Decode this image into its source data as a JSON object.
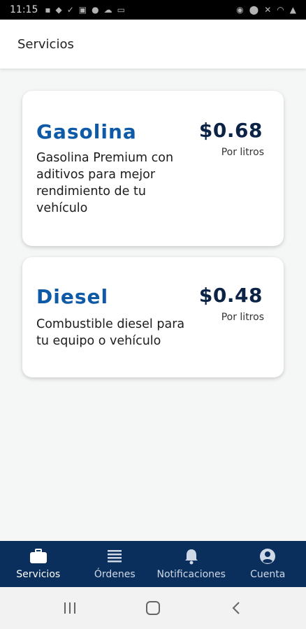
{
  "status_bar": {
    "time": "11:15"
  },
  "app_bar": {
    "title": "Servicios"
  },
  "services": [
    {
      "name": "Gasolina",
      "price": "$0.68",
      "unit": "Por litros",
      "description": "Gasolina Premium con aditivos para mejor rendimiento de tu vehículo"
    },
    {
      "name": "Diesel",
      "price": "$0.48",
      "unit": "Por litros",
      "description": "Combustible diesel para tu equipo o vehículo"
    }
  ],
  "bottom_nav": {
    "items": [
      {
        "label": "Servicios",
        "icon": "briefcase-icon",
        "active": true
      },
      {
        "label": "Órdenes",
        "icon": "list-icon",
        "active": false
      },
      {
        "label": "Notificaciones",
        "icon": "bell-icon",
        "active": false
      },
      {
        "label": "Cuenta",
        "icon": "account-circle-icon",
        "active": false
      }
    ]
  },
  "colors": {
    "brand_blue": "#0e5aa7",
    "price_navy": "#0b2345",
    "nav_background": "#0b2f5c"
  }
}
